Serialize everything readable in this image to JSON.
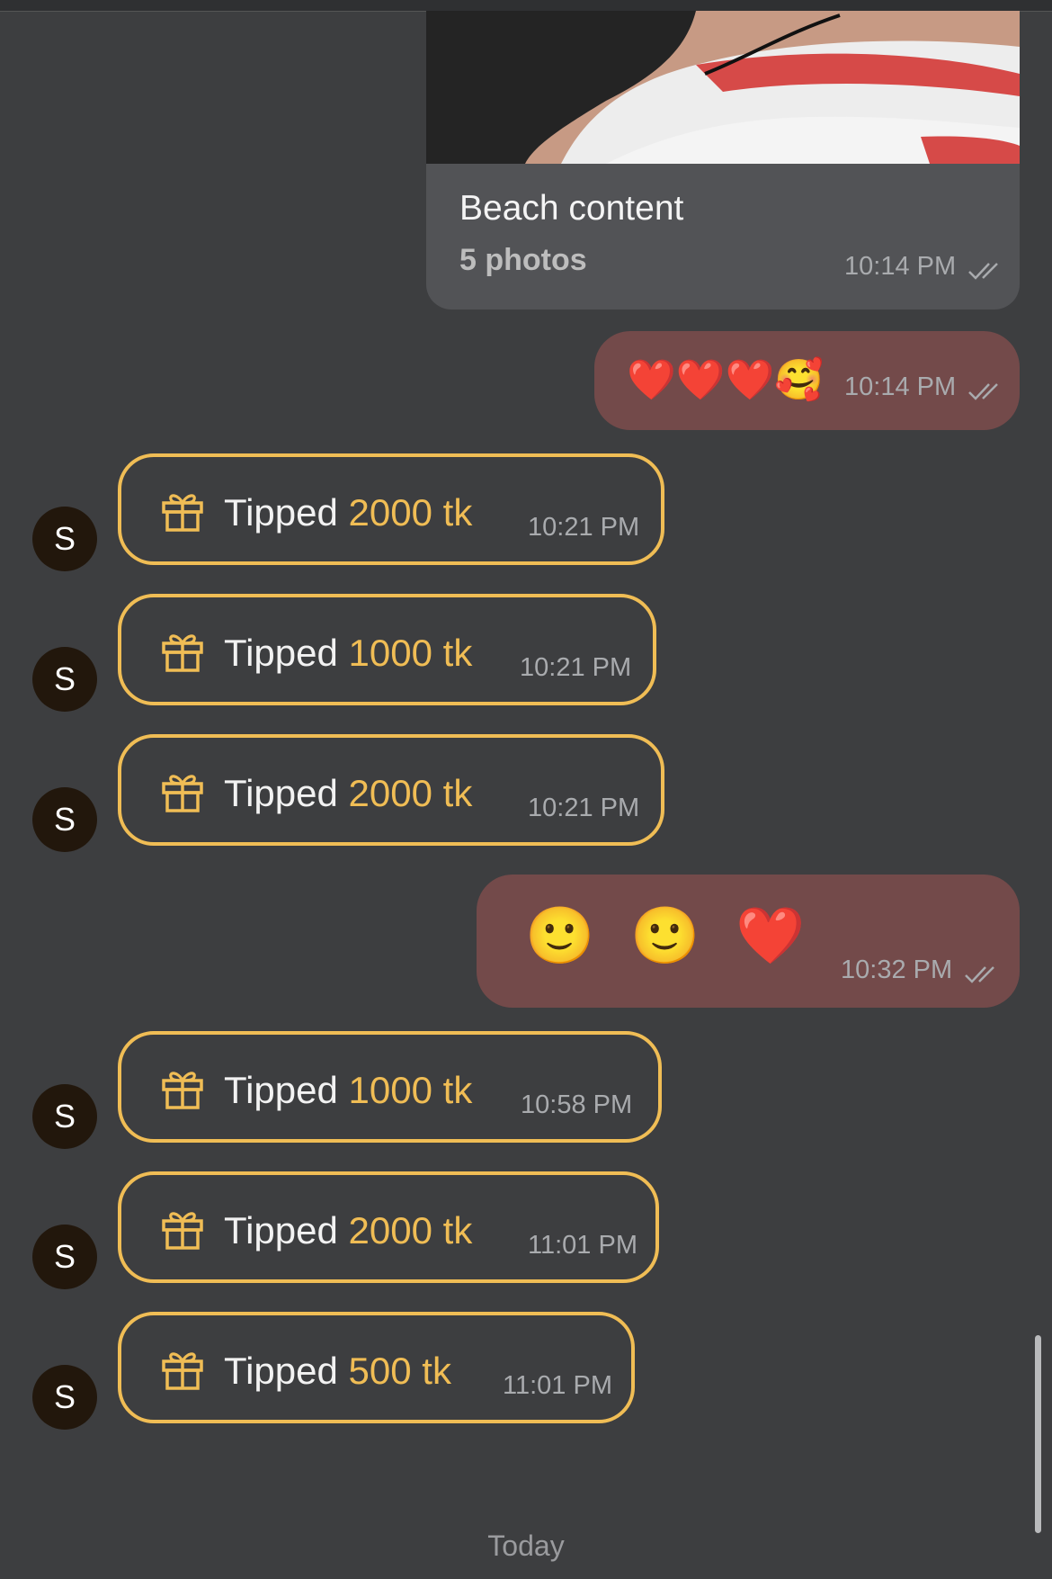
{
  "media_message": {
    "caption": "Beach content",
    "count": "5 photos",
    "time": "10:14 PM"
  },
  "reply_1": {
    "emojis": [
      "❤️",
      "❤️",
      "❤️",
      "🥰"
    ],
    "time": "10:14 PM"
  },
  "tips": [
    {
      "avatar": "S",
      "word": "Tipped",
      "amount": "2000 tk",
      "time": "10:21 PM"
    },
    {
      "avatar": "S",
      "word": "Tipped",
      "amount": "1000 tk",
      "time": "10:21 PM"
    },
    {
      "avatar": "S",
      "word": "Tipped",
      "amount": "2000 tk",
      "time": "10:21 PM"
    }
  ],
  "reply_2": {
    "emojis": [
      "🙂",
      "🙂",
      "❤️"
    ],
    "time": "10:32 PM"
  },
  "tips_2": [
    {
      "avatar": "S",
      "word": "Tipped",
      "amount": "1000 tk",
      "time": "10:58 PM"
    },
    {
      "avatar": "S",
      "word": "Tipped",
      "amount": "2000 tk",
      "time": "11:01 PM"
    },
    {
      "avatar": "S",
      "word": "Tipped",
      "amount": "500 tk",
      "time": "11:01 PM"
    }
  ],
  "day_separator": "Today",
  "colors": {
    "background": "#3d3e40",
    "outgoing_bubble": "#734a4a",
    "tip_accent": "#f0bd55",
    "media_bubble": "#525356"
  }
}
